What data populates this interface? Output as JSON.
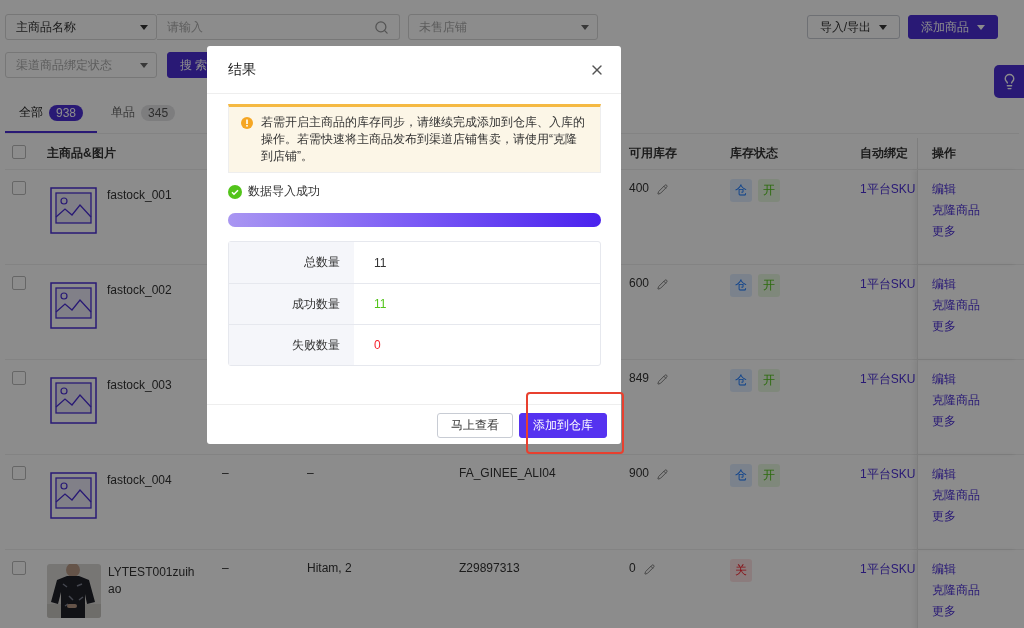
{
  "filters": {
    "name_select": {
      "value": "主商品名称"
    },
    "keyword": {
      "placeholder": "请输入"
    },
    "store_select": {
      "placeholder": "未售店铺"
    },
    "bind_status_select": {
      "placeholder": "渠道商品绑定状态"
    },
    "search_button": "搜 索"
  },
  "toolbar": {
    "import_export": "导入/导出",
    "add_product": "添加商品"
  },
  "tabs": [
    {
      "label": "全部",
      "count": "938",
      "selected": true
    },
    {
      "label": "单品",
      "count": "345",
      "selected": false
    }
  ],
  "table": {
    "select_all": {
      "checked": false
    },
    "columns": [
      {
        "label": "主商品&图片"
      },
      {
        "label": "可用库存"
      },
      {
        "label": "库存状态"
      },
      {
        "label": "自动绑定"
      },
      {
        "label": "操作"
      }
    ],
    "rows": [
      {
        "checked": false,
        "image": {
          "kind": "placeholder"
        },
        "name": "fastock_001",
        "stock": "400",
        "tags": [
          {
            "text": "仓",
            "kind": "warehouse"
          },
          {
            "text": "开",
            "kind": "on"
          }
        ],
        "binding": "1平台SKU",
        "actions": [
          "编辑",
          "克隆商品",
          "更多"
        ]
      },
      {
        "checked": false,
        "image": {
          "kind": "placeholder"
        },
        "name": "fastock_002",
        "stock": "600",
        "tags": [
          {
            "text": "仓",
            "kind": "warehouse"
          },
          {
            "text": "开",
            "kind": "on"
          }
        ],
        "binding": "1平台SKU",
        "actions": [
          "编辑",
          "克隆商品",
          "更多"
        ]
      },
      {
        "checked": false,
        "image": {
          "kind": "placeholder"
        },
        "name": "fastock_003",
        "stock": "849",
        "tags": [
          {
            "text": "仓",
            "kind": "warehouse"
          },
          {
            "text": "开",
            "kind": "on"
          }
        ],
        "binding": "1平台SKU",
        "actions": [
          "编辑",
          "克隆商品",
          "更多"
        ]
      },
      {
        "checked": false,
        "image": {
          "kind": "placeholder"
        },
        "name": "fastock_004",
        "column_2": "–",
        "column_3": "–",
        "column_4": "FA_GINEE_ALI04",
        "stock": "900",
        "tags": [
          {
            "text": "仓",
            "kind": "warehouse"
          },
          {
            "text": "开",
            "kind": "on"
          }
        ],
        "binding": "1平台SKU",
        "actions": [
          "编辑",
          "克隆商品",
          "更多"
        ]
      },
      {
        "checked": false,
        "image": {
          "kind": "picture"
        },
        "name": "LYTEST001zuihao",
        "column_2": "–",
        "column_3": "Hitam, 2",
        "column_4": "Z29897313",
        "stock": "0",
        "tags": [
          {
            "text": "关",
            "kind": "off"
          }
        ],
        "binding": "1平台SKU",
        "actions": [
          "编辑",
          "克隆商品",
          "更多"
        ]
      }
    ]
  },
  "dialog": {
    "title": "结果",
    "notice": "若需开启主商品的库存同步，请继续完成添加到仓库、入库的操作。若需快速将主商品发布到渠道店铺售卖，请使用“克隆到店铺”。",
    "status": "数据导入成功",
    "progress": {
      "level": 1
    },
    "stats": [
      {
        "label": "总数量",
        "value": "11",
        "kind": "total"
      },
      {
        "label": "成功数量",
        "value": "11",
        "kind": "success"
      },
      {
        "label": "失败数量",
        "value": "0",
        "kind": "fail"
      }
    ],
    "buttons": [
      {
        "label": "马上查看",
        "kind": "default"
      },
      {
        "label": "添加到仓库",
        "kind": "primary"
      }
    ]
  }
}
